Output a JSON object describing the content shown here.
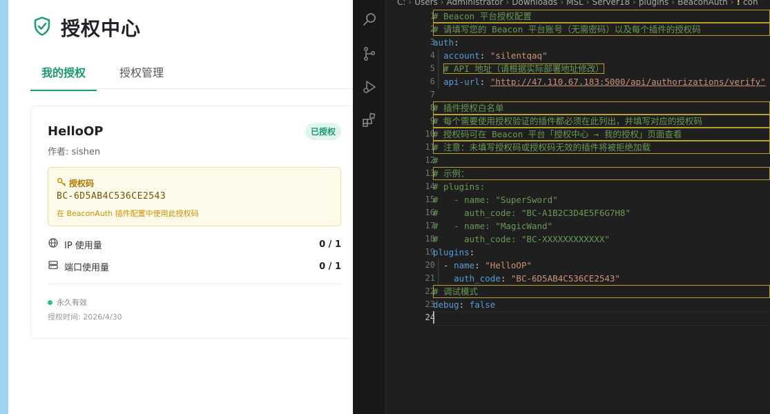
{
  "web": {
    "page_title": "授权中心",
    "tabs": [
      {
        "label": "我的授权",
        "active": true
      },
      {
        "label": "授权管理",
        "active": false
      }
    ],
    "plugin": {
      "name": "HelloOP",
      "author": "作者: sishen",
      "status_badge": "已授权",
      "code_label": "授权码",
      "code_value": "BC-6D5AB4C536CE2543",
      "code_hint": "在 BeaconAuth 插件配置中使用此授权码",
      "usage": [
        {
          "icon": "globe-icon",
          "label": "IP 使用量",
          "value": "0 / 1"
        },
        {
          "icon": "server-icon",
          "label": "端口使用量",
          "value": "0 / 1"
        }
      ],
      "validity": "永久有效",
      "auth_time": "授权时间: 2026/4/30"
    },
    "colors": {
      "accent": "#1a9b6b",
      "badge_bg": "#e1f5ec",
      "code_bg": "#fffbea"
    }
  },
  "editor": {
    "breadcrumb": [
      "C:",
      "Users",
      "Administrator",
      "Downloads",
      "MSL",
      "Server18",
      "plugins",
      "BeaconAuth",
      "!",
      "con"
    ],
    "line_numbers": [
      "1",
      "2",
      "3",
      "4",
      "5",
      "6",
      "7",
      "8",
      "9",
      "10",
      "11",
      "12",
      "13",
      "14",
      "15",
      "16",
      "17",
      "18",
      "19",
      "20",
      "21",
      "22",
      "23",
      "24"
    ],
    "lines": {
      "l1": "# Beacon 平台授权配置",
      "l2": "# 请填写您的 Beacon 平台账号（无需密码）以及每个插件的授权码",
      "l3_key": "auth",
      "l4_key": "account",
      "l4_val": "\"silentqaq\"",
      "l5": "# API 地址（请根据实际部署地址修改）",
      "l6_key": "api-url",
      "l6_val": "\"http://47.110.67.183:5000/api/authorizations/verify\"",
      "l8": "# 插件授权白名单",
      "l9": "# 每个需要使用授权验证的插件都必须在此列出，并填写对应的授权码",
      "l10": "# 授权码可在 Beacon 平台「授权中心 → 我的授权」页面查看",
      "l11": "# 注意：未填写授权码或授权码无效的插件将被拒绝加载",
      "l12": "#",
      "l13": "# 示例：",
      "l14": "# plugins:",
      "l15": "#   - name: \"SuperSword\"",
      "l16": "#     auth_code: \"BC-A1B2C3D4E5F6G7H8\"",
      "l17": "#   - name: \"MagicWand\"",
      "l18": "#     auth_code: \"BC-XXXXXXXXXXXX\"",
      "l19_key": "plugins",
      "l20_key": "name",
      "l20_val": "\"HelloOP\"",
      "l21_key": "auth_code",
      "l21_val": "\"BC-6D5AB4C536CE2543\"",
      "l22": "# 调试模式",
      "l23_key": "debug",
      "l23_val": "false"
    }
  }
}
